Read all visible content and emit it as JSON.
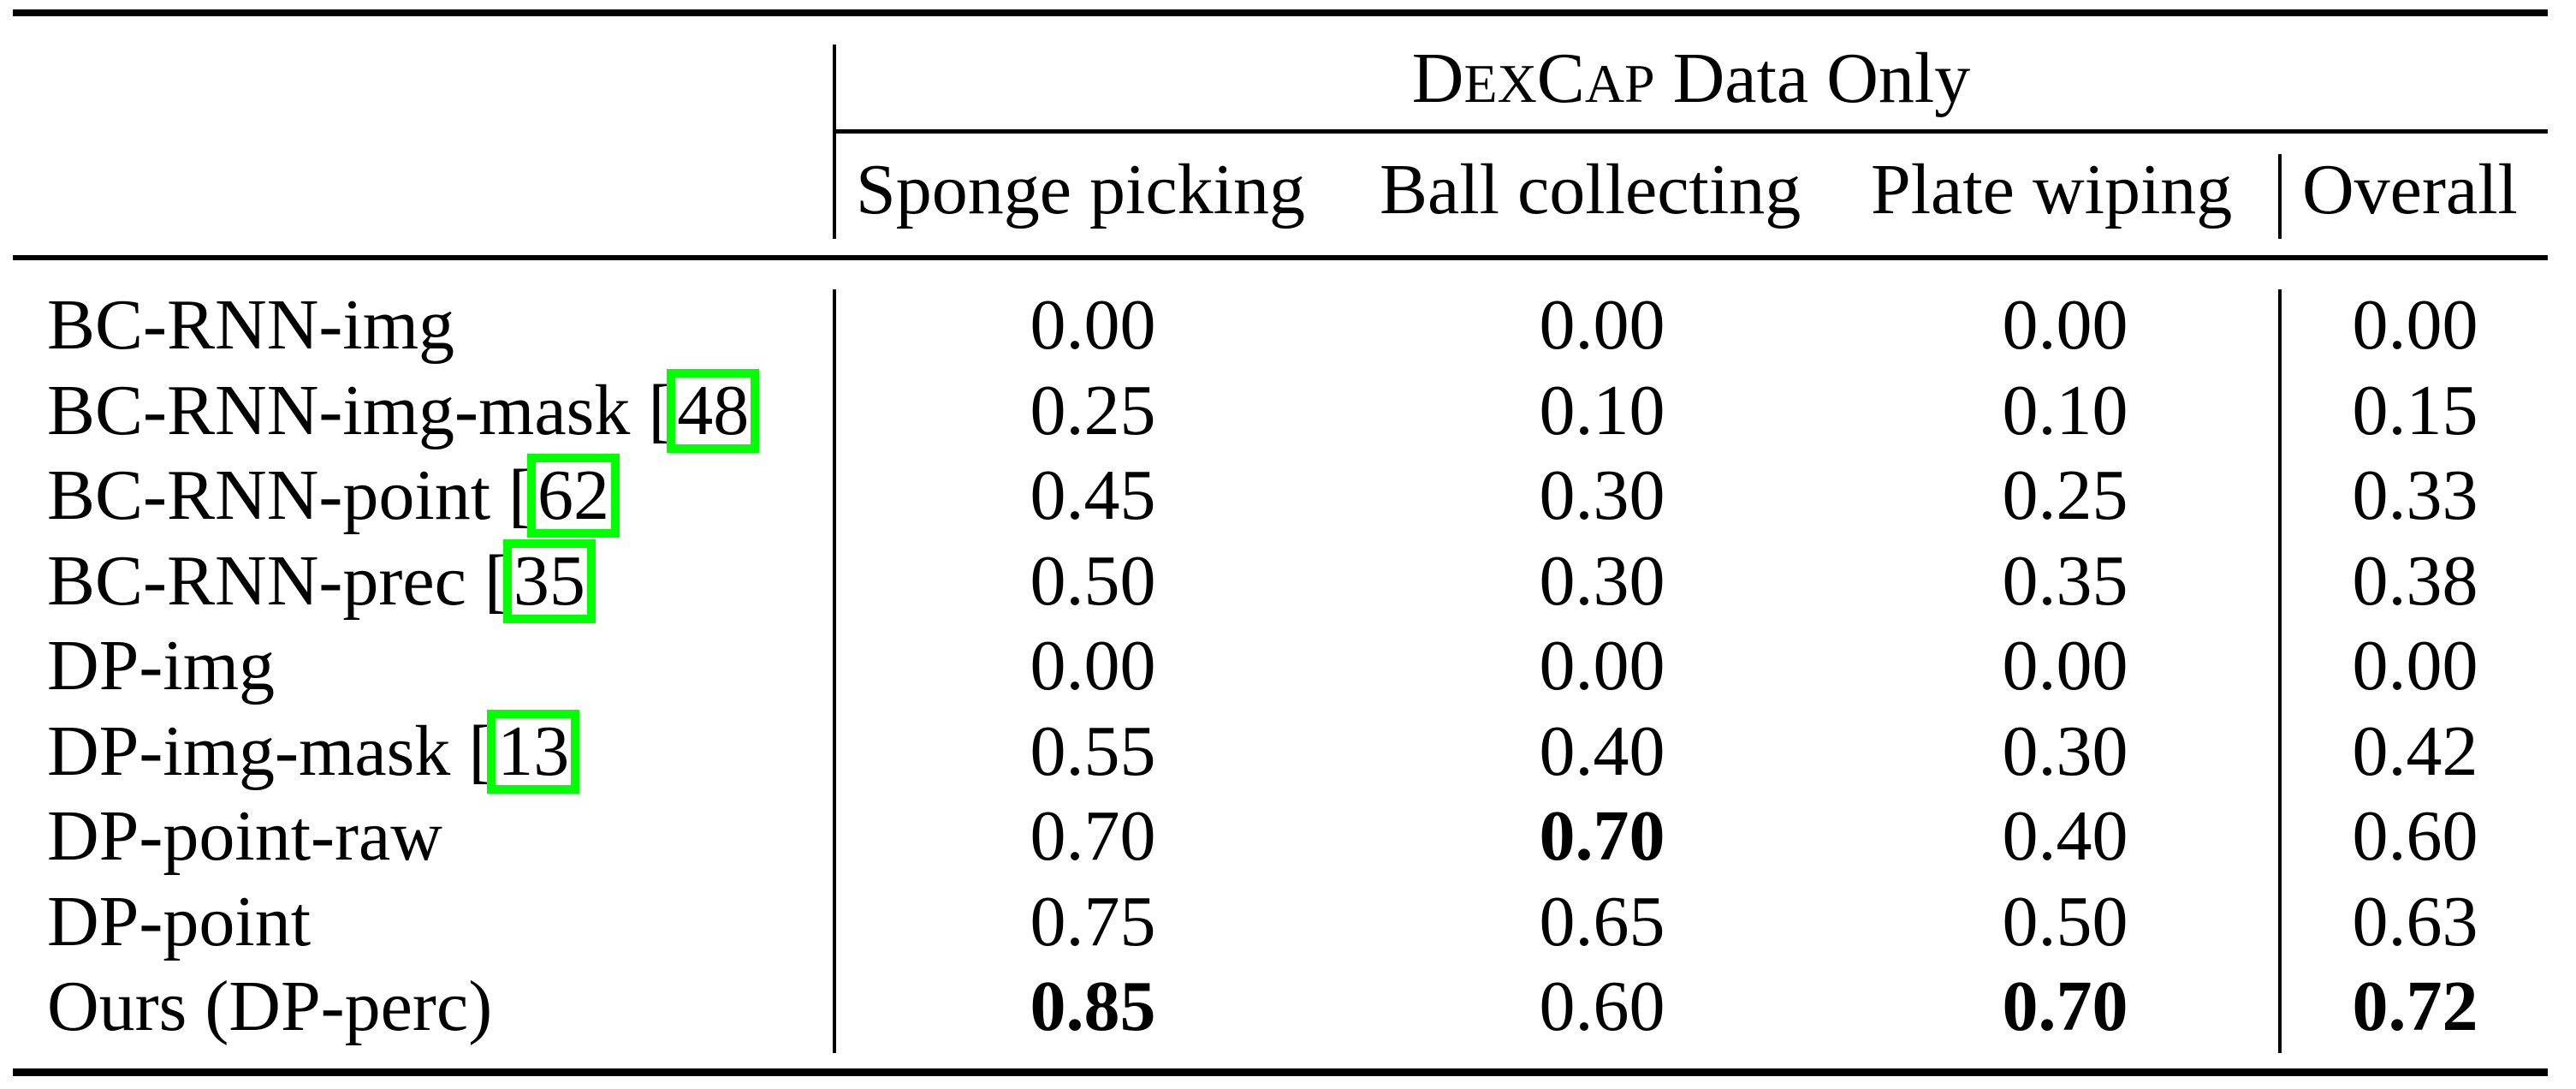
{
  "table": {
    "group_header": {
      "sc_parts": [
        {
          "big": "D",
          "small": "EX"
        },
        {
          "big": "C",
          "small": "AP"
        }
      ],
      "rest": " Data Only"
    },
    "columns": [
      "Sponge picking",
      "Ball collecting",
      "Plate wiping",
      "Overall"
    ],
    "rows": [
      {
        "method": "BC-RNN-img",
        "cite": null,
        "values": [
          "0.00",
          "0.00",
          "0.00",
          "0.00"
        ],
        "bold": [
          false,
          false,
          false,
          false
        ]
      },
      {
        "method": "BC-RNN-img-mask",
        "cite": "48",
        "values": [
          "0.25",
          "0.10",
          "0.10",
          "0.15"
        ],
        "bold": [
          false,
          false,
          false,
          false
        ]
      },
      {
        "method": "BC-RNN-point",
        "cite": "62",
        "values": [
          "0.45",
          "0.30",
          "0.25",
          "0.33"
        ],
        "bold": [
          false,
          false,
          false,
          false
        ]
      },
      {
        "method": "BC-RNN-prec",
        "cite": "35",
        "values": [
          "0.50",
          "0.30",
          "0.35",
          "0.38"
        ],
        "bold": [
          false,
          false,
          false,
          false
        ]
      },
      {
        "method": "DP-img",
        "cite": null,
        "values": [
          "0.00",
          "0.00",
          "0.00",
          "0.00"
        ],
        "bold": [
          false,
          false,
          false,
          false
        ]
      },
      {
        "method": "DP-img-mask",
        "cite": "13",
        "values": [
          "0.55",
          "0.40",
          "0.30",
          "0.42"
        ],
        "bold": [
          false,
          false,
          false,
          false
        ]
      },
      {
        "method": "DP-point-raw",
        "cite": null,
        "values": [
          "0.70",
          "0.70",
          "0.40",
          "0.60"
        ],
        "bold": [
          false,
          true,
          false,
          false
        ]
      },
      {
        "method": "DP-point",
        "cite": null,
        "values": [
          "0.75",
          "0.65",
          "0.50",
          "0.63"
        ],
        "bold": [
          false,
          false,
          false,
          false
        ]
      },
      {
        "method": "Ours (DP-perc)",
        "cite": null,
        "values": [
          "0.85",
          "0.60",
          "0.70",
          "0.72"
        ],
        "bold": [
          true,
          false,
          true,
          true
        ]
      }
    ]
  },
  "colors": {
    "citation_box": "#00ff00",
    "text": "#000000"
  }
}
